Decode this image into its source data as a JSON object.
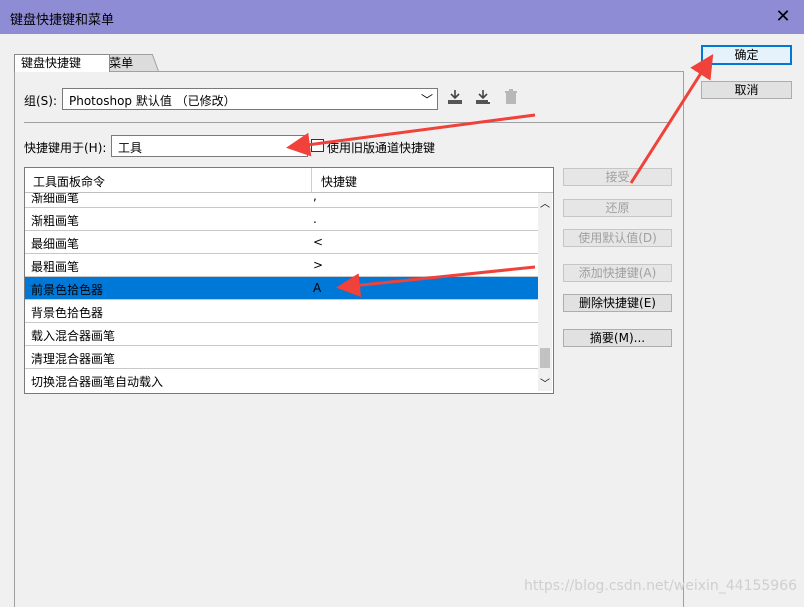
{
  "window": {
    "title": "键盘快捷键和菜单",
    "close_glyph": "✕"
  },
  "tabs": [
    {
      "label": "键盘快捷键"
    },
    {
      "label": "菜单"
    }
  ],
  "group": {
    "label": "组(S):",
    "value": "Photoshop 默认值 （已修改）"
  },
  "toolbar_icons": [
    "save-set-icon",
    "save-as-set-icon",
    "delete-set-icon"
  ],
  "shortcuts_for": {
    "label": "快捷键用于(H):",
    "value": "工具"
  },
  "legacy_checkbox": {
    "label": "使用旧版通道快捷键",
    "checked": false
  },
  "table": {
    "columns": [
      "工具面板命令",
      "快捷键"
    ],
    "rows": [
      {
        "command": "渐细画笔",
        "key": ",",
        "partial": true
      },
      {
        "command": "渐粗画笔",
        "key": "."
      },
      {
        "command": "最细画笔",
        "key": "<"
      },
      {
        "command": "最粗画笔",
        "key": ">"
      },
      {
        "command": "前景色拾色器",
        "key": "A",
        "selected": true
      },
      {
        "command": "背景色拾色器",
        "key": ""
      },
      {
        "command": "载入混合器画笔",
        "key": ""
      },
      {
        "command": "清理混合器画笔",
        "key": ""
      },
      {
        "command": "切换混合器画笔自动载入",
        "key": ""
      }
    ]
  },
  "buttons": {
    "ok": "确定",
    "cancel": "取消",
    "accept": "接受",
    "undo": "还原",
    "use_default": "使用默认值(D)",
    "add_shortcut": "添加快捷键(A)",
    "delete_shortcut": "删除快捷键(E)",
    "summarize": "摘要(M)..."
  },
  "watermark": "https://blog.csdn.net/weixin_44155966",
  "colors": {
    "titlebar": "#8f8cd6",
    "selection": "#0078d7",
    "annotation_arrow": "#f0413a"
  }
}
